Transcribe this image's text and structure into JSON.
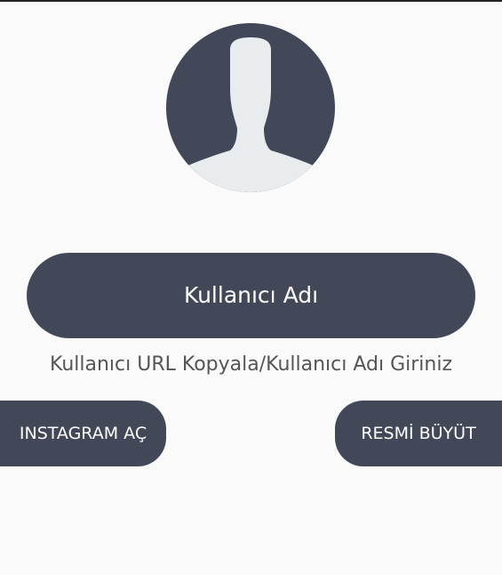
{
  "avatar": {
    "icon": "default-user-icon",
    "background_color": "#434859",
    "silhouette_color": "#e8ecee"
  },
  "username": {
    "value": "Kullanıcı Adı"
  },
  "hint": {
    "text": "Kullanıcı URL Kopyala/Kullanıcı Adı Giriniz"
  },
  "buttons": {
    "instagram_label": "INSTAGRAM AÇ",
    "enlarge_label": "RESMİ BÜYÜT"
  },
  "colors": {
    "accent": "#434859",
    "background": "#fafafa",
    "text_on_accent": "#ffffff",
    "hint_text": "#555555"
  }
}
